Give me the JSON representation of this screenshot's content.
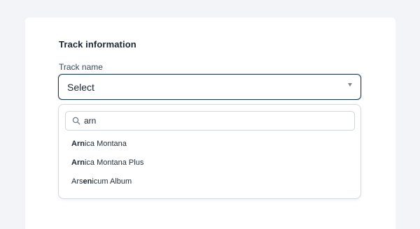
{
  "form": {
    "section_title": "Track information",
    "track_name_label": "Track name",
    "select_value": "Select"
  },
  "dropdown": {
    "search_value": "arn",
    "options": [
      {
        "pre": "",
        "match": "Arn",
        "post": "ica Montana"
      },
      {
        "pre": "",
        "match": "Arn",
        "post": "ica Montana Plus"
      },
      {
        "pre": "Ars",
        "match": "en",
        "post": "icum Album"
      }
    ]
  },
  "colors": {
    "select_border": "#1f3f4e",
    "page_background": "#f3f4f7"
  }
}
